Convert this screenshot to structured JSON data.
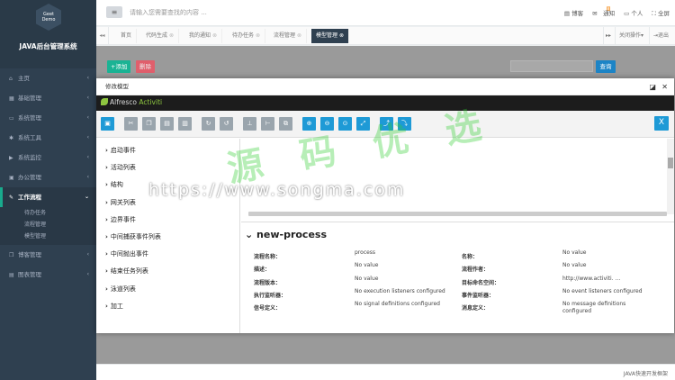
{
  "app": {
    "logo_text": "Geet Demo",
    "title": "JAVA后台管理系统"
  },
  "sidebar": {
    "items": [
      {
        "label": "主页",
        "icon": "home-icon"
      },
      {
        "label": "基础管理",
        "icon": "grid-icon"
      },
      {
        "label": "系统管理",
        "icon": "desktop-icon"
      },
      {
        "label": "系统工具",
        "icon": "gear-icon"
      },
      {
        "label": "系统监控",
        "icon": "video-icon"
      },
      {
        "label": "办公管理",
        "icon": "briefcase-icon"
      },
      {
        "label": "工作流程",
        "icon": "edit-icon"
      },
      {
        "label": "博客管理",
        "icon": "book-icon"
      },
      {
        "label": "图表管理",
        "icon": "chart-icon"
      }
    ],
    "sub_items": [
      "待办任务",
      "流程管理",
      "模型管理"
    ]
  },
  "topbar": {
    "search_placeholder": "请输入您需要查找的内容 ...",
    "blog": "博客",
    "notify": "通知",
    "notify_count": "8",
    "personal": "个人",
    "fullscreen": "全屏"
  },
  "tabs": {
    "items": [
      "首页",
      "代码生成",
      "我的通知",
      "待办任务",
      "流程管理",
      "模型管理"
    ],
    "close_ops": "关闭操作",
    "exit": "退出"
  },
  "content": {
    "add": "+添加",
    "delete": "删除",
    "query": "查询"
  },
  "modal": {
    "title": "修改模型"
  },
  "modeler": {
    "brand": "Alfresco",
    "brand_accent": "Activiti",
    "palette": [
      "启动事件",
      "活动列表",
      "结构",
      "网关列表",
      "边界事件",
      "中间捕获事件列表",
      "中间抛出事件",
      "结束任务列表",
      "泳道列表",
      "加工"
    ],
    "process_title": "new-process",
    "props": [
      {
        "label": "流程名称：",
        "value": "process",
        "label2": "名称：",
        "value2": "No value"
      },
      {
        "label": "描述：",
        "value": "No value",
        "label2": "流程作者：",
        "value2": "No value"
      },
      {
        "label": "流程版本：",
        "value": "No value",
        "label2": "目标命名空间：",
        "value2": "http://www.activiti. ..."
      },
      {
        "label": "执行监听器：",
        "value": "No execution listeners configured",
        "label2": "事件监听器：",
        "value2": "No event listeners configured"
      },
      {
        "label": "信号定义：",
        "value": "No signal definitions configured",
        "label2": "消息定义：",
        "value2": "No message definitions configured"
      }
    ]
  },
  "watermark": {
    "url": "https://www.songma.com",
    "cn": "源 码 优 选"
  },
  "footer": {
    "text": "JAVA快速开发框架"
  }
}
